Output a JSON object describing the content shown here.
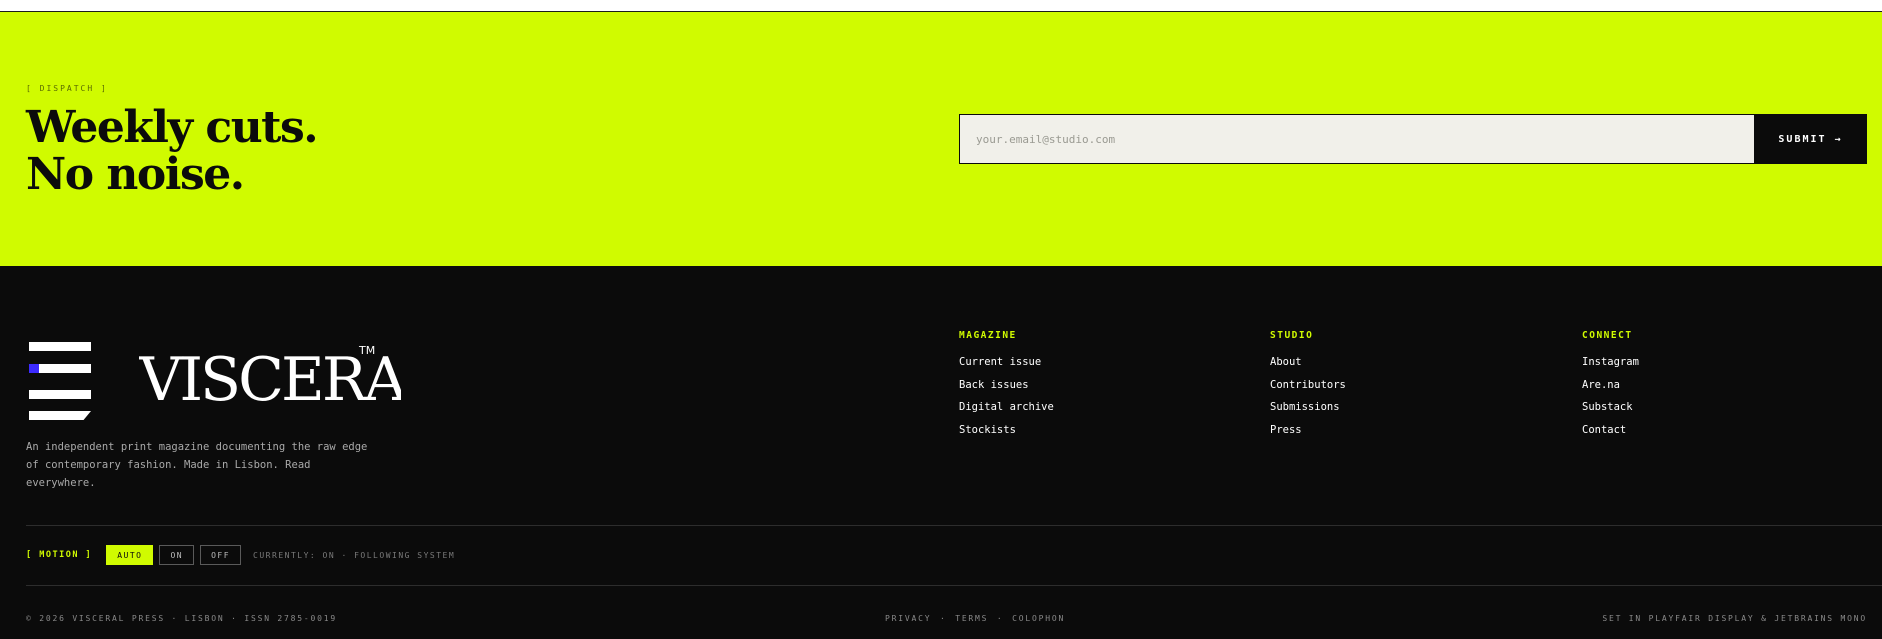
{
  "dispatch": {
    "tag": "[ DISPATCH ]",
    "title_line1": "Weekly cuts.",
    "title_line2": "No noise.",
    "email_placeholder": "your.email@studio.com",
    "submit_label": "SUBMIT →"
  },
  "brand": {
    "wordmark": "VISCERAL",
    "trademark": "TM",
    "description": "An independent print magazine documenting the raw edge of contemporary fashion. Made in Lisbon. Read everywhere.",
    "accent_color": "#d0fb00",
    "mark_dot_color": "#3d2bff",
    "logo_icon": "stacked-bars-logo-icon"
  },
  "columns": [
    {
      "title": "MAGAZINE",
      "links": [
        "Current issue",
        "Back issues",
        "Digital archive",
        "Stockists"
      ]
    },
    {
      "title": "STUDIO",
      "links": [
        "About",
        "Contributors",
        "Submissions",
        "Press"
      ]
    },
    {
      "title": "CONNECT",
      "links": [
        "Instagram",
        "Are.na",
        "Substack",
        "Contact"
      ]
    }
  ],
  "motion": {
    "label": "[ MOTION ]",
    "options": [
      "AUTO",
      "ON",
      "OFF"
    ],
    "selected": "AUTO",
    "status": "CURRENTLY: ON · FOLLOWING SYSTEM"
  },
  "bottom": {
    "copyright": "© 2026 VISCERAL PRESS · LISBON · ISSN 2785-0019",
    "links": [
      "PRIVACY",
      "TERMS",
      "COLOPHON"
    ],
    "separator": "·",
    "colophon": "SET IN PLAYFAIR DISPLAY & JETBRAINS MONO"
  }
}
